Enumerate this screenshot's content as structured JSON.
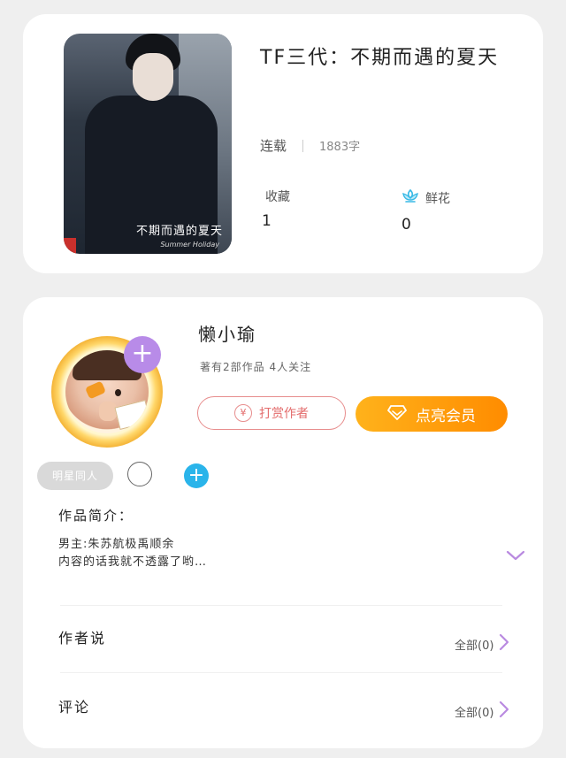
{
  "book": {
    "title": "TF三代：不期而遇的夏天",
    "status": "连载",
    "word_count": "1883字",
    "favorites_label": "收藏",
    "favorites_value": "1",
    "flowers_label": "鲜花",
    "flowers_value": "0",
    "cover_caption": "不期而遇的夏天",
    "cover_caption_en": "Summer Holiday"
  },
  "author": {
    "name": "懒小瑜",
    "stats": "著有2部作品 4人关注",
    "tip_button": "打赏作者",
    "vip_button": "点亮会员",
    "tag": "明星同人"
  },
  "intro": {
    "label": "作品简介：",
    "line1": "男主:朱苏航极禹顺余",
    "line2": "内容的话我就不透露了哟…"
  },
  "author_says": {
    "label": "作者说",
    "link": "全部(0)"
  },
  "comments": {
    "label": "评论",
    "link": "全部(0)"
  },
  "colors": {
    "vip": "#ff9a0a",
    "tip": "#e36b6b",
    "accent_purple": "#b88be8",
    "accent_blue": "#2ab4ea"
  }
}
